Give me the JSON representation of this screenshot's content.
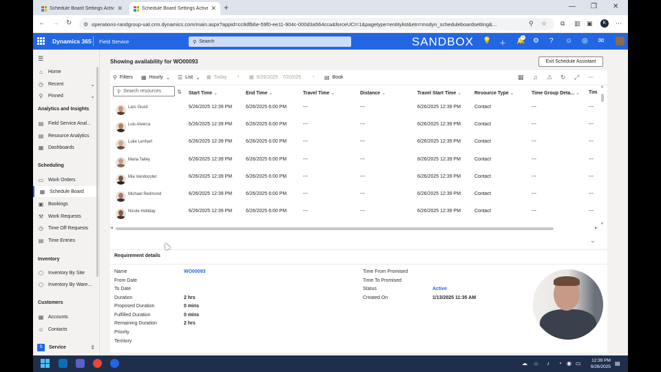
{
  "browser": {
    "tabs": [
      {
        "title": "Schedule Board Settings Active"
      },
      {
        "title": "Schedule Board Settings Active"
      }
    ],
    "url": "operations-randgroup-uat.crm.dynamics.com/main.aspx?appid=cc8dfb6e-59f0-ee11-904c-000d3a564cca&forceUCI=1&pagetype=entitylist&etn=msdyn_scheduleboardsetting&...",
    "profile_initial": "K"
  },
  "app_header": {
    "app_name": "Dynamics 365",
    "area": "Field Service",
    "search_placeholder": "Search",
    "environment": "SANDBOX",
    "notification_count": "1",
    "brand_color": "#2266e3"
  },
  "sidebar": {
    "items_top": [
      {
        "label": "Home",
        "icon": "home-icon"
      },
      {
        "label": "Recent",
        "icon": "clock-icon"
      },
      {
        "label": "Pinned",
        "icon": "pin-icon"
      }
    ],
    "groups": [
      {
        "heading": "Analytics and Insights",
        "items": [
          {
            "label": "Field Service Anal..."
          },
          {
            "label": "Resource Analytics"
          },
          {
            "label": "Dashboards"
          }
        ]
      },
      {
        "heading": "Scheduling",
        "items": [
          {
            "label": "Work Orders"
          },
          {
            "label": "Schedule Board"
          },
          {
            "label": "Bookings"
          },
          {
            "label": "Work Requests"
          },
          {
            "label": "Time Off Requests"
          },
          {
            "label": "Time Entries"
          }
        ]
      },
      {
        "heading": "Inventory",
        "items": [
          {
            "label": "Inventory By Site"
          },
          {
            "label": "Inventory By Ware..."
          }
        ]
      },
      {
        "heading": "Customers",
        "items": [
          {
            "label": "Accounts"
          },
          {
            "label": "Contacts"
          }
        ]
      }
    ],
    "area_switcher": {
      "badge": "S",
      "label": "Service"
    }
  },
  "page": {
    "title": "Showing availability for WO00093",
    "exit_button": "Exit Schedule Assistant"
  },
  "toolbar": {
    "filters": "Filters",
    "hourly": "Hourly",
    "list": "List",
    "today": "Today",
    "date_range": "6/26/2025 - 7/2/2025",
    "book": "Book"
  },
  "grid": {
    "search_placeholder": "Search resources",
    "columns": [
      "Start Time",
      "End Time",
      "Travel Time",
      "Distance",
      "Travel Start Time",
      "Resource Type",
      "Time Group Deta...",
      "Tim"
    ],
    "rows": [
      {
        "name": "Lars Giusti",
        "start": "6/26/2025 12:39 PM",
        "end": "6/26/2025 6:00 PM",
        "travel": "---",
        "distance": "---",
        "travel_start": "6/26/2025 12:39 PM",
        "type": "Contact",
        "tgd": "---",
        "tim": "---"
      },
      {
        "name": "Luis Alverca",
        "start": "6/26/2025 12:39 PM",
        "end": "6/26/2025 6:00 PM",
        "travel": "---",
        "distance": "---",
        "travel_start": "6/26/2025 12:39 PM",
        "type": "Contact",
        "tgd": "---",
        "tim": "---"
      },
      {
        "name": "Luke Lenhart",
        "start": "6/26/2025 12:39 PM",
        "end": "6/26/2025 6:00 PM",
        "travel": "---",
        "distance": "---",
        "travel_start": "6/26/2025 12:39 PM",
        "type": "Contact",
        "tgd": "---",
        "tim": "---"
      },
      {
        "name": "Maria Talley",
        "start": "6/26/2025 12:39 PM",
        "end": "6/26/2025 6:00 PM",
        "travel": "---",
        "distance": "---",
        "travel_start": "6/26/2025 12:39 PM",
        "type": "Contact",
        "tgd": "---",
        "tim": "---"
      },
      {
        "name": "Mia Vandooster",
        "start": "6/26/2025 12:39 PM",
        "end": "6/26/2025 6:00 PM",
        "travel": "---",
        "distance": "---",
        "travel_start": "6/26/2025 12:39 PM",
        "type": "Contact",
        "tgd": "---",
        "tim": "---"
      },
      {
        "name": "Michael Redmond",
        "start": "6/26/2025 12:39 PM",
        "end": "6/26/2025 6:00 PM",
        "travel": "---",
        "distance": "---",
        "travel_start": "6/26/2025 12:39 PM",
        "type": "Contact",
        "tgd": "---",
        "tim": "---"
      },
      {
        "name": "Nicole Holliday",
        "start": "6/26/2025 12:39 PM",
        "end": "6/26/2025 6:00 PM",
        "travel": "---",
        "distance": "---",
        "travel_start": "6/26/2025 12:39 PM",
        "type": "Contact",
        "tgd": "---",
        "tim": "---"
      }
    ]
  },
  "details": {
    "title": "Requirement details",
    "left": [
      {
        "label": "Name",
        "value": "WO00093"
      },
      {
        "label": "From Date",
        "value": ""
      },
      {
        "label": "To Date",
        "value": ""
      },
      {
        "label": "Duration",
        "value": "2 hrs"
      },
      {
        "label": "Proposed Duration",
        "value": "0 mins"
      },
      {
        "label": "Fulfilled Duration",
        "value": "0 mins"
      },
      {
        "label": "Remaining Duration",
        "value": "2 hrs"
      },
      {
        "label": "Priority",
        "value": ""
      },
      {
        "label": "Territory",
        "value": ""
      }
    ],
    "right": [
      {
        "label": "Time From Promised",
        "value": ""
      },
      {
        "label": "Time To Promised",
        "value": ""
      },
      {
        "label": "Status",
        "value": "Active"
      },
      {
        "label": "Created On",
        "value": "1/13/2025 11:35 AM"
      }
    ]
  },
  "taskbar": {
    "time": "12:39 PM",
    "date": "6/26/2025"
  }
}
